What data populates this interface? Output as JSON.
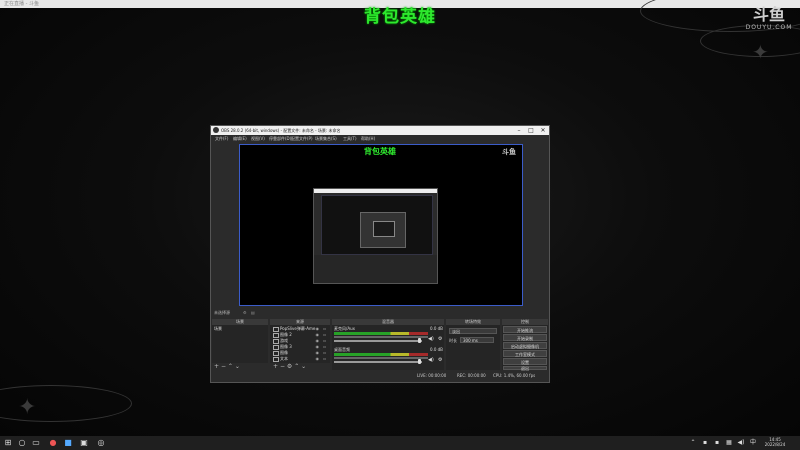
{
  "browser_strip": {
    "text": "正在直播 - 斗鱼"
  },
  "stream": {
    "title": "背包英雄",
    "douyu_cn": "斗鱼",
    "douyu_en": "DOUYU.COM"
  },
  "obs": {
    "title": "OBS 28.0.2 (64-bit, windows) - 配置文件: 未命名 - 场景: 未命名",
    "window_buttons": {
      "minimize": "–",
      "maximize": "□",
      "close": "✕"
    },
    "menu": [
      "文件(F)",
      "编辑(E)",
      "视图(V)",
      "停靠部件(D)",
      "配置文件(P)",
      "场景集合(S)",
      "工具(T)",
      "帮助(H)"
    ],
    "preview": {
      "title": "背包英雄",
      "douyu": "斗鱼"
    },
    "no_source": "未选择源",
    "scenes": {
      "header": "场景",
      "items": [
        "场景"
      ]
    },
    "sources": {
      "header": "来源",
      "items": [
        {
          "label": "PopSlive弹幕-Ame"
        },
        {
          "label": "图像 2"
        },
        {
          "label": "游戏"
        },
        {
          "label": "图像 3"
        },
        {
          "label": "图像"
        },
        {
          "label": "文本"
        }
      ]
    },
    "mixer": {
      "header": "混音器",
      "channels": [
        {
          "name": "麦克风/Aux",
          "db": "0.0 dB"
        },
        {
          "name": "桌面音频",
          "db": "0.0 dB"
        }
      ]
    },
    "transitions": {
      "header": "转场特效",
      "type": "淡出",
      "duration_label": "时长",
      "duration": "300 ms"
    },
    "controls": {
      "header": "控制",
      "buttons": [
        "开始推流",
        "开始录制",
        "启动虚拟摄像机",
        "工作室模式",
        "设置",
        "退出"
      ]
    },
    "status": {
      "live": "LIVE: 00:00:00",
      "rec": "REC: 00:00:00",
      "cpu": "CPU: 1.4%, 60.00 fps"
    }
  },
  "taskbar": {
    "time": "14:45",
    "date": "2022/8/24",
    "lang": "中"
  }
}
